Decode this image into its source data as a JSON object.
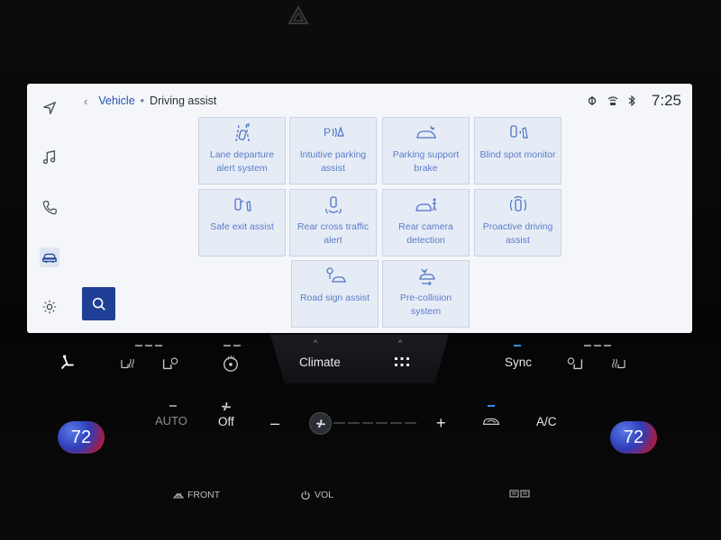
{
  "breadcrumb": {
    "back": "‹",
    "parent": "Vehicle",
    "separator": "•",
    "current": "Driving assist"
  },
  "status": {
    "time": "7:25"
  },
  "tiles": [
    {
      "label": "Lane departure alert system",
      "icon": "lane-departure-icon"
    },
    {
      "label": "Intuitive parking assist",
      "icon": "parking-sensor-icon"
    },
    {
      "label": "Parking support brake",
      "icon": "parking-brake-icon"
    },
    {
      "label": "Blind spot monitor",
      "icon": "blind-spot-icon"
    },
    {
      "label": "Safe exit assist",
      "icon": "safe-exit-icon"
    },
    {
      "label": "Rear cross traffic alert",
      "icon": "cross-traffic-icon"
    },
    {
      "label": "Rear camera detection",
      "icon": "rear-camera-icon"
    },
    {
      "label": "Proactive driving assist",
      "icon": "proactive-drive-icon"
    },
    {
      "label": "Road sign assist",
      "icon": "road-sign-icon"
    },
    {
      "label": "Pre-collision system",
      "icon": "pre-collision-icon"
    }
  ],
  "sidebar": [
    "navigation-icon",
    "music-icon",
    "phone-icon",
    "car-icon",
    "settings-icon"
  ],
  "climate": {
    "tab_label": "Climate",
    "sync_label": "Sync",
    "auto_label": "AUTO",
    "off_label": "Off",
    "minus": "–",
    "plus": "+",
    "ac_label": "A/C",
    "left_temp": "72",
    "right_temp": "72",
    "front_label": "FRONT",
    "vol_label": "VOL"
  },
  "colors": {
    "accent": "#1f3f96",
    "tile_text": "#5b7cc8",
    "indicator": "#2f8de8"
  }
}
